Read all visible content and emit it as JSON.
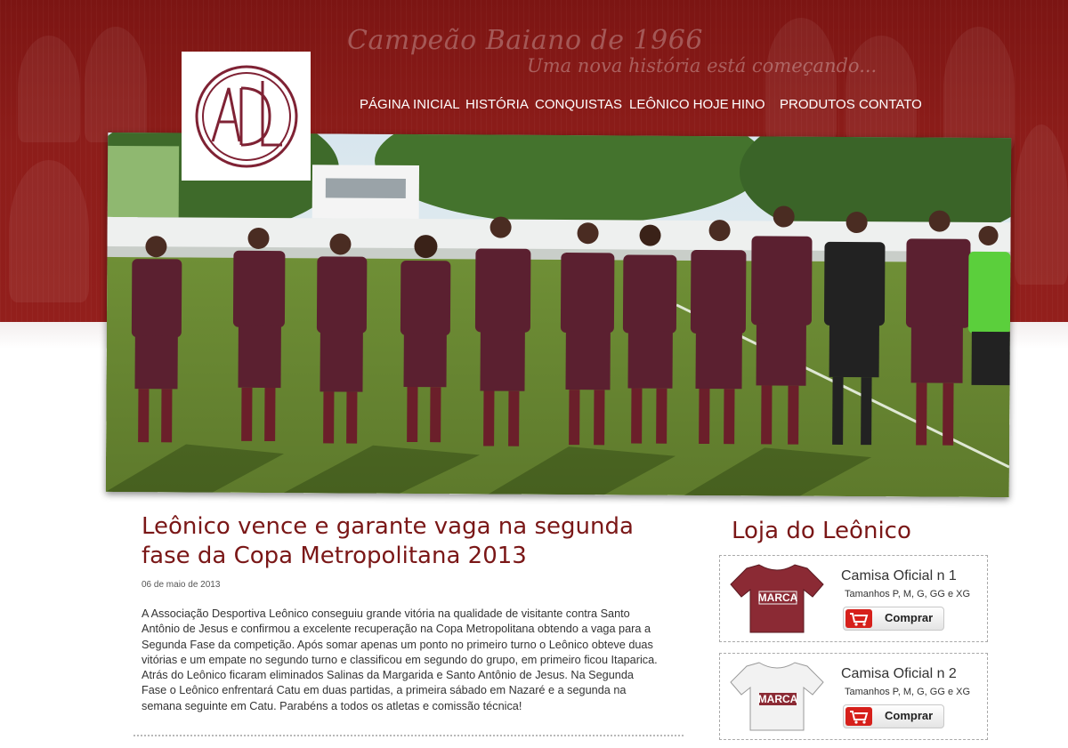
{
  "header": {
    "tagline_main": "Campeão Baiano de 1966",
    "tagline_sub": "Uma nova história está começando...",
    "logo_text": "ADL"
  },
  "nav": {
    "items": [
      {
        "label": "PÁGINA INICIAL"
      },
      {
        "label": "HISTÓRIA"
      },
      {
        "label": "CONQUISTAS"
      },
      {
        "label": "LEÔNICO HOJE"
      },
      {
        "label": "HINO"
      },
      {
        "label": "PRODUTOS"
      },
      {
        "label": "CONTATO"
      }
    ]
  },
  "article": {
    "title": "Leônico vence e garante vaga na segunda fase da Copa Metropolitana 2013",
    "date": "06 de maio de 2013",
    "body": "A Associação Desportiva Leônico conseguiu grande vitória na qualidade de visitante contra Santo Antônio de Jesus e confirmou a excelente recuperação na Copa Metropolitana obtendo a vaga para a Segunda Fase da competição. Após somar apenas um ponto no primeiro turno o Leônico obteve duas vitórias e um empate no segundo turno e classificou em segundo do grupo, em primeiro ficou Itaparica. Atrás do Leônico ficaram eliminados Salinas da Margarida e Santo Antônio de Jesus. Na Segunda Fase o Leônico enfrentará Catu em duas partidas, a primeira sábado em Nazaré e a segunda na semana seguinte em Catu. Parabéns a todos os atletas e comissão técnica!"
  },
  "shop": {
    "title": "Loja do Leônico",
    "products": [
      {
        "name": "Camisa Oficial n 1",
        "sizes": "Tamanhos P, M, G, GG e XG",
        "button": "Comprar",
        "shirt_text": "MARCA",
        "shirt_color": "#8b2a34"
      },
      {
        "name": "Camisa Oficial n 2",
        "sizes": "Tamanhos P, M, G, GG e XG",
        "button": "Comprar",
        "shirt_text": "MARCA",
        "shirt_color": "#f2f2f2"
      }
    ]
  },
  "colors": {
    "brand": "#8d1d1a",
    "heading": "#7a1717",
    "button_cart": "#d6201b"
  }
}
